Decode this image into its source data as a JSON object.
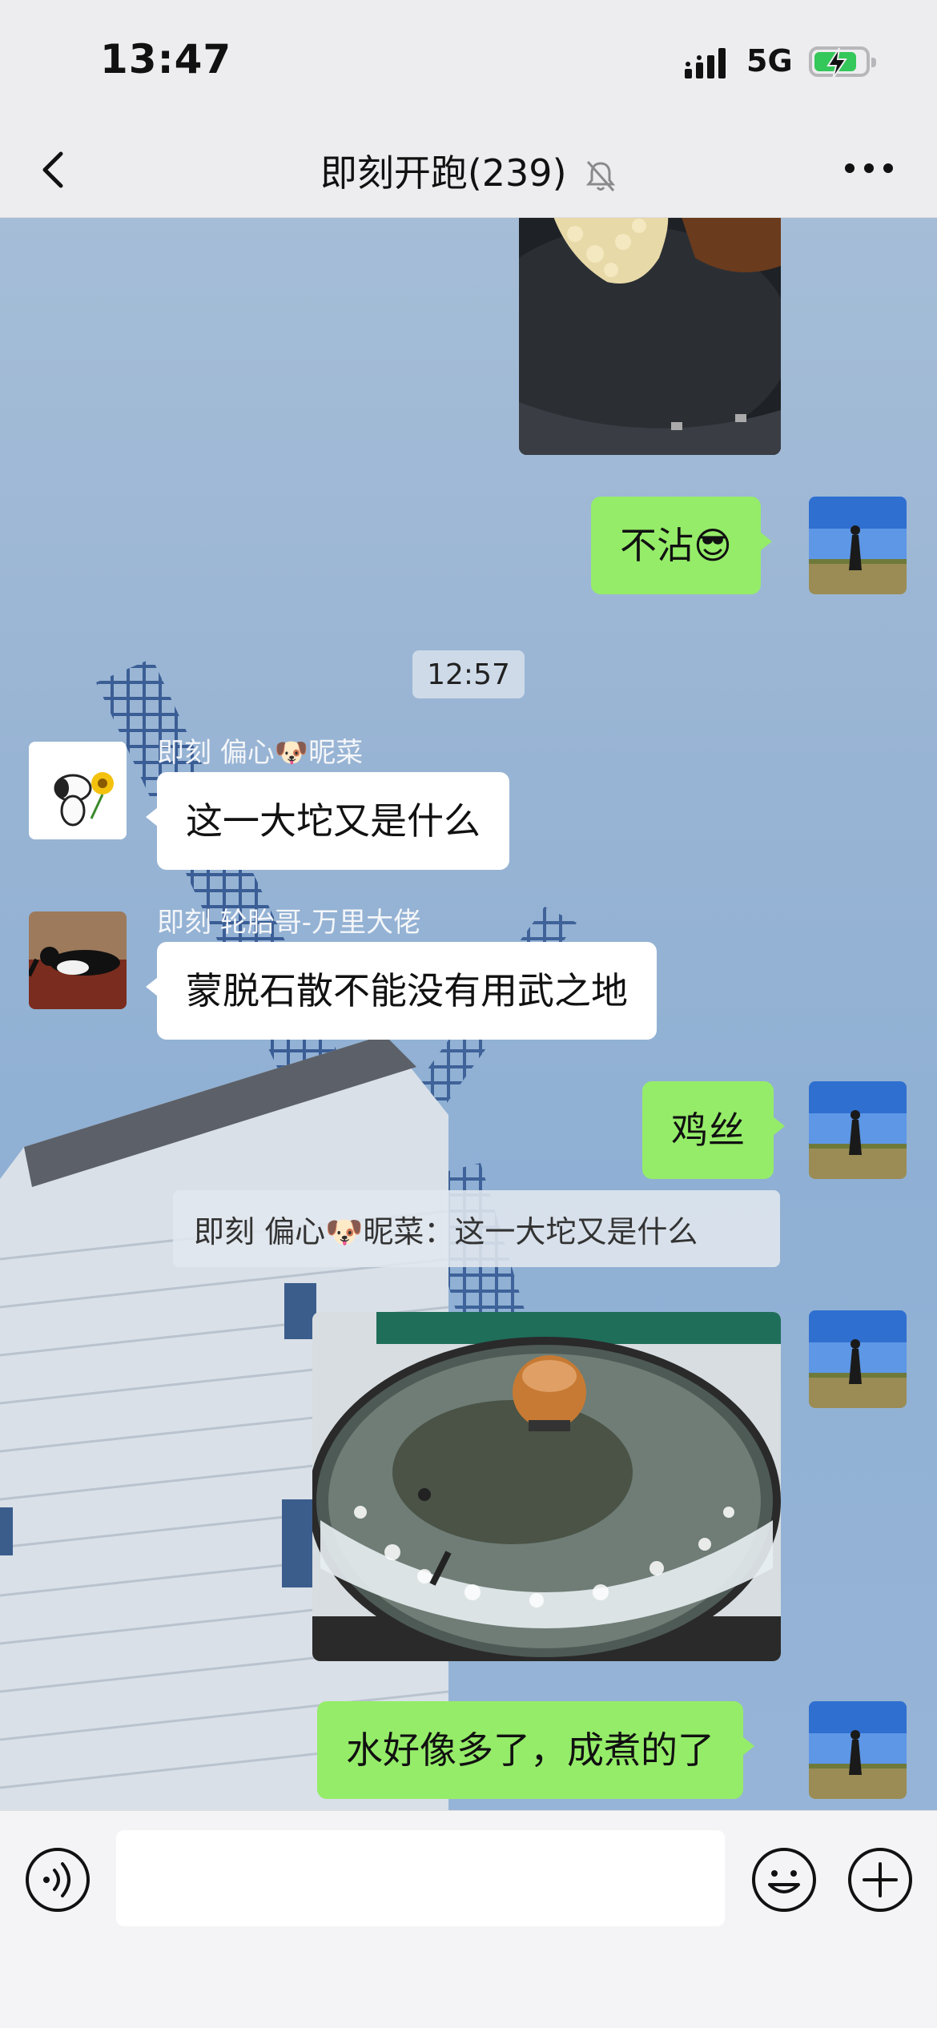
{
  "status_bar": {
    "time": "13:47",
    "network": "5G",
    "battery_icon": "battery-charging-icon",
    "signal_icon": "signal-bars-icon"
  },
  "nav": {
    "back_icon": "chevron-left-icon",
    "title": "即刻开跑(239)",
    "mute_icon": "bell-muted-icon",
    "more_icon": "more-dots-icon"
  },
  "messages": {
    "m1": {
      "type": "image",
      "from": "me"
    },
    "m2": {
      "type": "text",
      "from": "me",
      "text": "不沾😎"
    },
    "timestamp": "12:57",
    "m3": {
      "type": "text",
      "from": "other",
      "sender": "即刻 偏心🐶昵菜",
      "text": "这一大坨又是什么"
    },
    "m4": {
      "type": "text",
      "from": "other",
      "sender": "即刻 轮胎哥-万里大佬",
      "text": "蒙脱石散不能没有用武之地"
    },
    "m5": {
      "type": "text",
      "from": "me",
      "text": "鸡丝"
    },
    "quote": {
      "text": "即刻 偏心🐶昵菜：这一大坨又是什么"
    },
    "m6": {
      "type": "image",
      "from": "me"
    },
    "m7": {
      "type": "text",
      "from": "me",
      "text": "水好像多了，成煮的了"
    }
  },
  "input_bar": {
    "voice_icon": "voice-icon",
    "emoji_icon": "emoji-icon",
    "plus_icon": "plus-icon",
    "text_value": ""
  },
  "colors": {
    "my_bubble": "#95ec69",
    "other_bubble": "#ffffff",
    "bar_bg": "#ededef"
  }
}
